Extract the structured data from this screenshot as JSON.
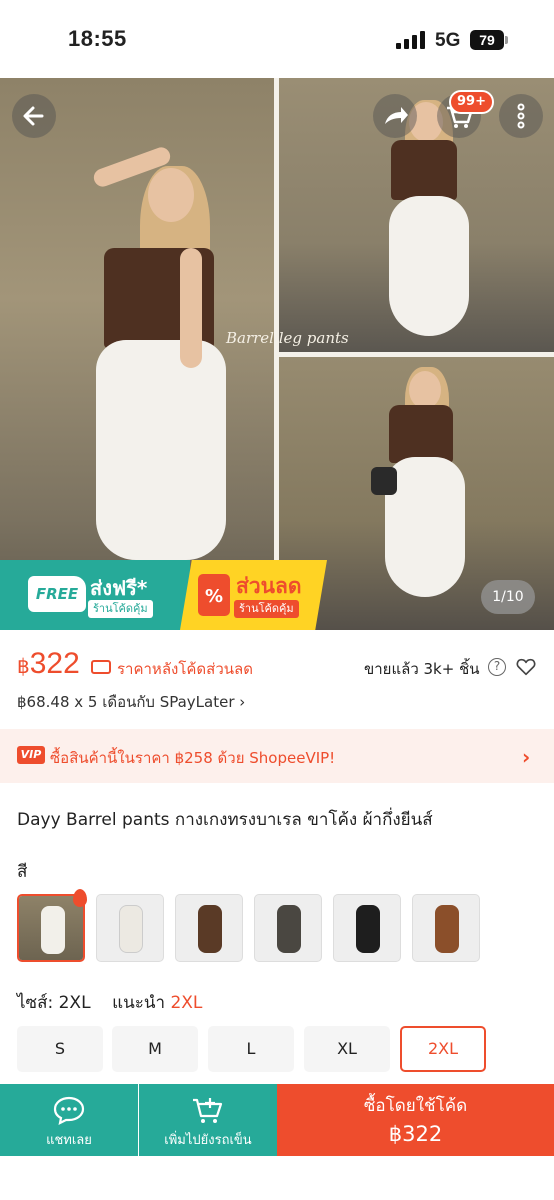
{
  "status_bar": {
    "time": "18:55",
    "network": "5G",
    "battery": "79"
  },
  "product_image": {
    "watermark": "Barrel leg pants",
    "counter": "1/10",
    "cart_count": "99+"
  },
  "promo": {
    "free_badge": "FREE",
    "free_title": "ส่งฟรี*",
    "free_sub": "ร้านโค้ดคุ้ม",
    "sale_icon": "%",
    "sale_title": "ส่วนลด",
    "sale_sub": "ร้านโค้ดคุ้ม"
  },
  "price": {
    "currency": "฿",
    "value": "322",
    "note": "ราคาหลังโค้ดส่วนลด",
    "sold": "ขายแล้ว 3k+ ชิ้น",
    "installment": "฿68.48 x 5 เดือนกับ SPayLater ›"
  },
  "vip": {
    "badge": "VIP",
    "text": "ซื้อสินค้านี้ในราคา ฿258 ด้วย ShopeeVIP!",
    "chevron": "›"
  },
  "product": {
    "title": "Dayy Barrel pants กางเกงทรงบาเรล ขาโค้ง ผ้ากึ่งยีนส์",
    "color_label": "สี",
    "swatches": [
      {
        "color": "#f2f0ea",
        "selected": true
      },
      {
        "color": "#ece9e2"
      },
      {
        "color": "#5a3a26"
      },
      {
        "color": "#4a4741"
      },
      {
        "color": "#1e1e1e"
      },
      {
        "color": "#8b4f2a"
      }
    ],
    "size_label": "ไซส์:",
    "size_value": "2XL",
    "recommend_label": "แนะนำ",
    "recommend_value": "2XL",
    "sizes": [
      "S",
      "M",
      "L",
      "XL",
      "2XL"
    ]
  },
  "bottom_bar": {
    "chat_label": "แชทเลย",
    "cart_label": "เพิ่มไปยังรถเข็น",
    "buy_label": "ซื้อโดยใช้โค้ด",
    "buy_price": "฿322"
  },
  "colors": {
    "brand": "#ee4d2d",
    "teal": "#26aa99",
    "promo_yellow": "#ffd324"
  }
}
